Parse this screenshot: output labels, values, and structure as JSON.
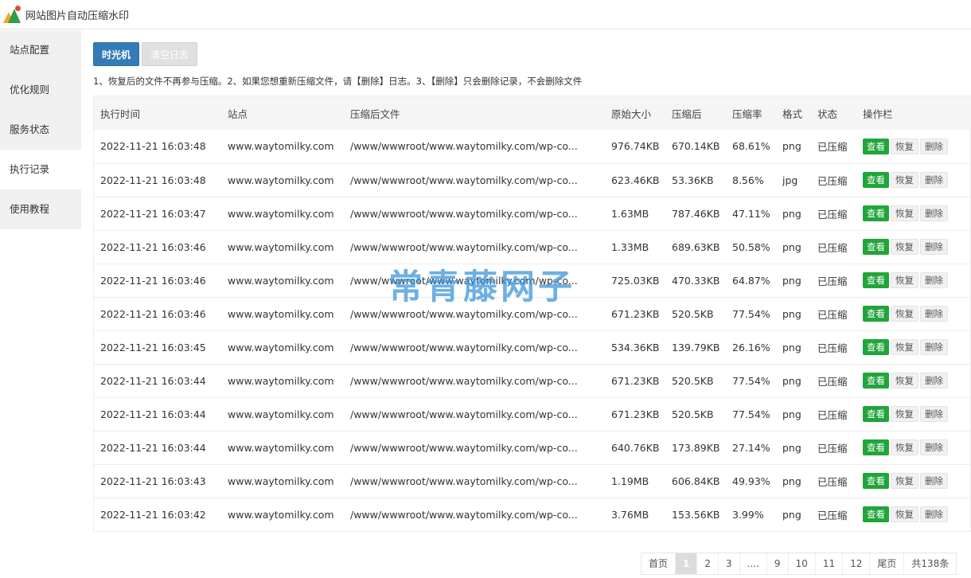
{
  "app": {
    "title": "网站图片自动压缩水印"
  },
  "sidebar": {
    "items": [
      {
        "label": "站点配置"
      },
      {
        "label": "优化规则"
      },
      {
        "label": "服务状态"
      },
      {
        "label": "执行记录",
        "active": true
      },
      {
        "label": "使用教程"
      }
    ]
  },
  "toolbar": {
    "timemachine": "时光机",
    "clear_log": "清空日志"
  },
  "notice": "1、恢复后的文件不再参与压缩。2、如果您想重新压缩文件，请【删除】日志。3、【删除】只会删除记录，不会删除文件",
  "table": {
    "headers": [
      "执行时间",
      "站点",
      "压缩后文件",
      "原始大小",
      "压缩后",
      "压缩率",
      "格式",
      "状态",
      "操作栏"
    ],
    "actions": {
      "view": "查看",
      "restore": "恢复",
      "delete": "删除"
    },
    "rows": [
      [
        "2022-11-21 16:03:48",
        "www.waytomilky.com",
        "/www/wwwroot/www.waytomilky.com/wp-co...",
        "976.74KB",
        "670.14KB",
        "68.61%",
        "png",
        "已压缩"
      ],
      [
        "2022-11-21 16:03:48",
        "www.waytomilky.com",
        "/www/wwwroot/www.waytomilky.com/wp-co...",
        "623.46KB",
        "53.36KB",
        "8.56%",
        "jpg",
        "已压缩"
      ],
      [
        "2022-11-21 16:03:47",
        "www.waytomilky.com",
        "/www/wwwroot/www.waytomilky.com/wp-co...",
        "1.63MB",
        "787.46KB",
        "47.11%",
        "png",
        "已压缩"
      ],
      [
        "2022-11-21 16:03:46",
        "www.waytomilky.com",
        "/www/wwwroot/www.waytomilky.com/wp-co...",
        "1.33MB",
        "689.63KB",
        "50.58%",
        "png",
        "已压缩"
      ],
      [
        "2022-11-21 16:03:46",
        "www.waytomilky.com",
        "/www/wwwroot/www.waytomilky.com/wp-co...",
        "725.03KB",
        "470.33KB",
        "64.87%",
        "png",
        "已压缩"
      ],
      [
        "2022-11-21 16:03:46",
        "www.waytomilky.com",
        "/www/wwwroot/www.waytomilky.com/wp-co...",
        "671.23KB",
        "520.5KB",
        "77.54%",
        "png",
        "已压缩"
      ],
      [
        "2022-11-21 16:03:45",
        "www.waytomilky.com",
        "/www/wwwroot/www.waytomilky.com/wp-co...",
        "534.36KB",
        "139.79KB",
        "26.16%",
        "png",
        "已压缩"
      ],
      [
        "2022-11-21 16:03:44",
        "www.waytomilky.com",
        "/www/wwwroot/www.waytomilky.com/wp-co...",
        "671.23KB",
        "520.5KB",
        "77.54%",
        "png",
        "已压缩"
      ],
      [
        "2022-11-21 16:03:44",
        "www.waytomilky.com",
        "/www/wwwroot/www.waytomilky.com/wp-co...",
        "671.23KB",
        "520.5KB",
        "77.54%",
        "png",
        "已压缩"
      ],
      [
        "2022-11-21 16:03:44",
        "www.waytomilky.com",
        "/www/wwwroot/www.waytomilky.com/wp-co...",
        "640.76KB",
        "173.89KB",
        "27.14%",
        "png",
        "已压缩"
      ],
      [
        "2022-11-21 16:03:43",
        "www.waytomilky.com",
        "/www/wwwroot/www.waytomilky.com/wp-co...",
        "1.19MB",
        "606.84KB",
        "49.93%",
        "png",
        "已压缩"
      ],
      [
        "2022-11-21 16:03:42",
        "www.waytomilky.com",
        "/www/wwwroot/www.waytomilky.com/wp-co...",
        "3.76MB",
        "153.56KB",
        "3.99%",
        "png",
        "已压缩"
      ]
    ]
  },
  "watermark": "常青藤网子",
  "pagination": {
    "first": "首页",
    "pages": [
      "1",
      "2",
      "3",
      "....",
      "9",
      "10",
      "11",
      "12"
    ],
    "current": "1",
    "last": "尾页",
    "total": "共138条"
  },
  "colors": {
    "primary": "#337ab7",
    "view_button": "#20a53a",
    "watermark": "#3c96dc"
  }
}
